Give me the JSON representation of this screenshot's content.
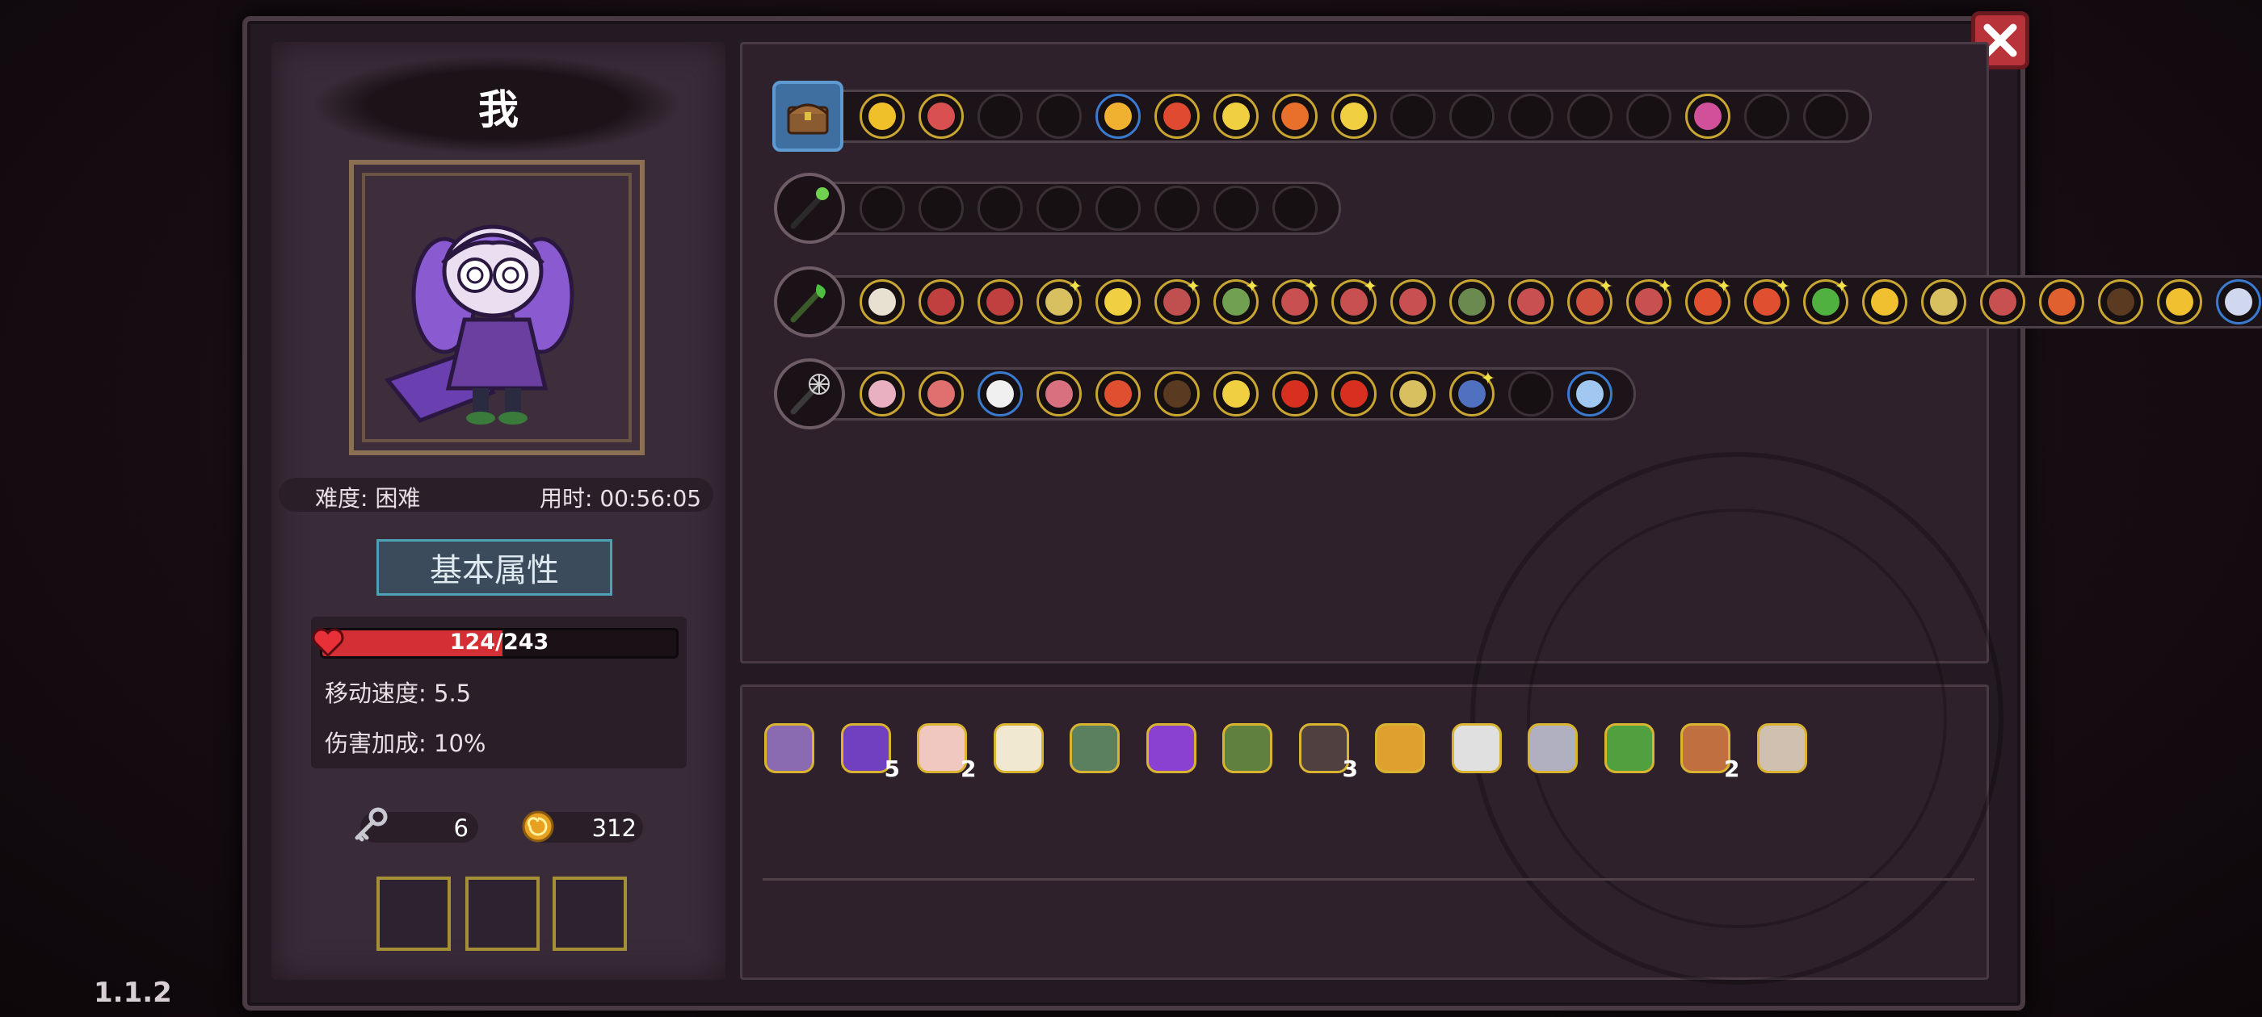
{
  "player": {
    "name": "我",
    "difficulty": "难度: 困难",
    "time": "用时: 00:56:05"
  },
  "tab": {
    "label": "基本属性"
  },
  "stats": {
    "hp_current": "124",
    "hp_sep": "/",
    "hp_max": "243",
    "hp_fraction": 0.51,
    "move_speed": "移动速度: 5.5",
    "damage_bonus": "伤害加成: 10%"
  },
  "resources": {
    "keys": "6",
    "coins": "312"
  },
  "version": "1.1.2",
  "colors": {
    "hp": "#d32f35",
    "gold_border": "#c9a632",
    "blue_border": "#3a7bd0",
    "accent_tab": "#4ea2b8"
  },
  "rows": [
    {
      "lead": "chest-icon",
      "slots": [
        {
          "c": "#f0c02a",
          "b": "filled"
        },
        {
          "c": "#d85050",
          "b": "filled"
        },
        {
          "c": "",
          "b": ""
        },
        {
          "c": "",
          "b": ""
        },
        {
          "c": "#f0b030",
          "b": "blue"
        },
        {
          "c": "#e04a30",
          "b": "filled"
        },
        {
          "c": "#f0d040",
          "b": "filled"
        },
        {
          "c": "#e8702a",
          "b": "filled"
        },
        {
          "c": "#f0d040",
          "b": "filled"
        },
        {
          "c": "",
          "b": ""
        },
        {
          "c": "",
          "b": ""
        },
        {
          "c": "",
          "b": ""
        },
        {
          "c": "",
          "b": ""
        },
        {
          "c": "",
          "b": ""
        },
        {
          "c": "#d0509a",
          "b": "filled"
        },
        {
          "c": "",
          "b": ""
        },
        {
          "c": "",
          "b": ""
        }
      ]
    },
    {
      "lead": "staff-icon",
      "slots": [
        {
          "c": "",
          "b": ""
        },
        {
          "c": "",
          "b": ""
        },
        {
          "c": "",
          "b": ""
        },
        {
          "c": "",
          "b": ""
        },
        {
          "c": "",
          "b": ""
        },
        {
          "c": "",
          "b": ""
        },
        {
          "c": "",
          "b": ""
        },
        {
          "c": "",
          "b": ""
        }
      ]
    },
    {
      "lead": "green-staff-icon",
      "slots": [
        {
          "c": "#e8e0d0",
          "b": "filled"
        },
        {
          "c": "#c04040",
          "b": "filled"
        },
        {
          "c": "#c04040",
          "b": "filled"
        },
        {
          "c": "#d8c060",
          "b": "filled",
          "p": true
        },
        {
          "c": "#f0d040",
          "b": "filled"
        },
        {
          "c": "#c05050",
          "b": "filled",
          "p": true
        },
        {
          "c": "#70a050",
          "b": "filled",
          "p": true
        },
        {
          "c": "#c85050",
          "b": "filled",
          "p": true
        },
        {
          "c": "#c85050",
          "b": "filled",
          "p": true
        },
        {
          "c": "#c85050",
          "b": "filled"
        },
        {
          "c": "#6a8a50",
          "b": "filled"
        },
        {
          "c": "#c85050",
          "b": "filled"
        },
        {
          "c": "#d05040",
          "b": "filled",
          "p": true
        },
        {
          "c": "#c85050",
          "b": "filled",
          "p": true
        },
        {
          "c": "#e05030",
          "b": "filled",
          "p": true
        },
        {
          "c": "#e05030",
          "b": "filled",
          "p": true
        },
        {
          "c": "#50b040",
          "b": "filled",
          "p": true
        },
        {
          "c": "#f0c030",
          "b": "filled"
        },
        {
          "c": "#d8c060",
          "b": "filled"
        },
        {
          "c": "#c85050",
          "b": "filled"
        },
        {
          "c": "#e06030",
          "b": "filled"
        },
        {
          "c": "#5a3a20",
          "b": "filled"
        },
        {
          "c": "#f0c030",
          "b": "filled"
        },
        {
          "c": "#d0d8f0",
          "b": "blue"
        }
      ]
    },
    {
      "lead": "web-staff-icon",
      "slots": [
        {
          "c": "#e8b0c0",
          "b": "filled"
        },
        {
          "c": "#e07070",
          "b": "filled"
        },
        {
          "c": "#f0f0f0",
          "b": "blue"
        },
        {
          "c": "#d87080",
          "b": "filled"
        },
        {
          "c": "#e05030",
          "b": "filled"
        },
        {
          "c": "#5a3a20",
          "b": "filled"
        },
        {
          "c": "#f0d040",
          "b": "filled"
        },
        {
          "c": "#d83020",
          "b": "filled"
        },
        {
          "c": "#d83020",
          "b": "filled"
        },
        {
          "c": "#d8c060",
          "b": "filled"
        },
        {
          "c": "#5070c0",
          "b": "filled",
          "p": true
        },
        {
          "c": "",
          "b": ""
        },
        {
          "c": "#a0c8f0",
          "b": "blue"
        }
      ]
    }
  ],
  "items": [
    {
      "name": "purple-hair-item",
      "c": "#8a6ab0",
      "count": ""
    },
    {
      "name": "wizard-hat-item",
      "c": "#7040c0",
      "count": "5"
    },
    {
      "name": "feather-item",
      "c": "#f0c8c0",
      "count": "2"
    },
    {
      "name": "fairy-wings-item",
      "c": "#f0e8d0",
      "count": ""
    },
    {
      "name": "dice-box-item",
      "c": "#5a8060",
      "count": ""
    },
    {
      "name": "purple-boot-item",
      "c": "#8a40d0",
      "count": ""
    },
    {
      "name": "green-goblin-item",
      "c": "#608040",
      "count": ""
    },
    {
      "name": "dark-cloak-item",
      "c": "#504040",
      "count": "3"
    },
    {
      "name": "golden-goblet-item",
      "c": "#e0a030",
      "count": ""
    },
    {
      "name": "spiral-glasses-item",
      "c": "#e0e0e0",
      "count": ""
    },
    {
      "name": "silver-crown-item",
      "c": "#b0b0c0",
      "count": ""
    },
    {
      "name": "green-boot-item",
      "c": "#50a040",
      "count": ""
    },
    {
      "name": "gauntlet-item",
      "c": "#c07040",
      "count": "2"
    },
    {
      "name": "bone-item",
      "c": "#d0c0b0",
      "count": ""
    }
  ]
}
